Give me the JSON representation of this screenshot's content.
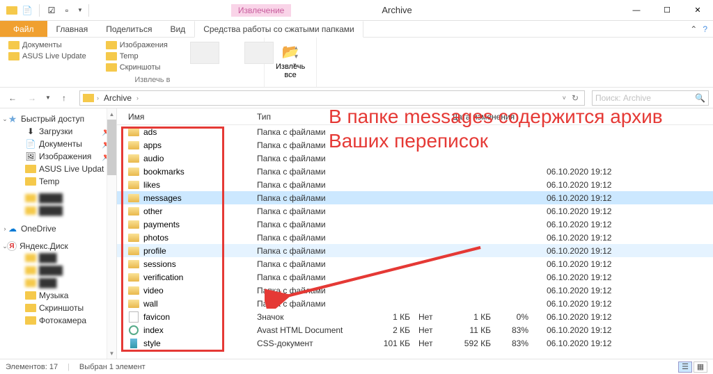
{
  "title": "Archive",
  "contextual_tab": "Извлечение",
  "tabs": {
    "file": "Файл",
    "home": "Главная",
    "share": "Поделиться",
    "view": "Вид",
    "tools": "Средства работы со сжатыми папками"
  },
  "ribbon": {
    "destinations": {
      "docs": "Документы",
      "images": "Изображения",
      "asus": "ASUS Live Update",
      "temp": "Temp",
      "screenshots": "Скриншоты"
    },
    "group_label": "Извлечь в",
    "extract_all": "Извлечь\nвсе"
  },
  "breadcrumb": [
    "Archive"
  ],
  "search_placeholder": "Поиск: Archive",
  "columns": {
    "name": "Имя",
    "type": "Тип",
    "date": "Дата изменения"
  },
  "tree": {
    "quick": "Быстрый доступ",
    "downloads": "Загрузки",
    "documents": "Документы",
    "images": "Изображения",
    "asus": "ASUS Live Updat",
    "temp": "Temp",
    "onedrive": "OneDrive",
    "yandex": "Яндекс.Диск",
    "music": "Музыка",
    "screenshots": "Скриншоты",
    "camera": "Фотокамера"
  },
  "files": [
    {
      "name": "ads",
      "icon": "folder",
      "type": "Папка с файлами",
      "date": null
    },
    {
      "name": "apps",
      "icon": "folder",
      "type": "Папка с файлами",
      "date": null
    },
    {
      "name": "audio",
      "icon": "folder",
      "type": "Папка с файлами",
      "date": null
    },
    {
      "name": "bookmarks",
      "icon": "folder",
      "type": "Папка с файлами",
      "date": "06.10.2020 19:12"
    },
    {
      "name": "likes",
      "icon": "folder",
      "type": "Папка с файлами",
      "date": "06.10.2020 19:12"
    },
    {
      "name": "messages",
      "icon": "folder",
      "type": "Папка с файлами",
      "date": "06.10.2020 19:12",
      "selected": true
    },
    {
      "name": "other",
      "icon": "folder",
      "type": "Папка с файлами",
      "date": "06.10.2020 19:12"
    },
    {
      "name": "payments",
      "icon": "folder",
      "type": "Папка с файлами",
      "date": "06.10.2020 19:12"
    },
    {
      "name": "photos",
      "icon": "folder",
      "type": "Папка с файлами",
      "date": "06.10.2020 19:12"
    },
    {
      "name": "profile",
      "icon": "folder",
      "type": "Папка с файлами",
      "date": "06.10.2020 19:12",
      "soft": true
    },
    {
      "name": "sessions",
      "icon": "folder",
      "type": "Папка с файлами",
      "date": "06.10.2020 19:12"
    },
    {
      "name": "verification",
      "icon": "folder",
      "type": "Папка с файлами",
      "date": "06.10.2020 19:12"
    },
    {
      "name": "video",
      "icon": "folder",
      "type": "Папка с файлами",
      "date": "06.10.2020 19:12"
    },
    {
      "name": "wall",
      "icon": "folder",
      "type": "Папка с файлами",
      "date": "06.10.2020 19:12"
    },
    {
      "name": "favicon",
      "icon": "file",
      "type": "Значок",
      "size1": "1 КБ",
      "enc": "Нет",
      "size2": "1 КБ",
      "pct": "0%",
      "date": "06.10.2020 19:12"
    },
    {
      "name": "index",
      "icon": "html",
      "type": "Avast HTML Document",
      "size1": "2 КБ",
      "enc": "Нет",
      "size2": "11 КБ",
      "pct": "83%",
      "date": "06.10.2020 19:12"
    },
    {
      "name": "style",
      "icon": "css",
      "type": "CSS-документ",
      "size1": "101 КБ",
      "enc": "Нет",
      "size2": "592 КБ",
      "pct": "83%",
      "date": "06.10.2020 19:12"
    }
  ],
  "status": {
    "count": "Элементов: 17",
    "selected": "Выбран 1 элемент"
  },
  "annotation": "В папке messages содержится архив Ваших переписок"
}
